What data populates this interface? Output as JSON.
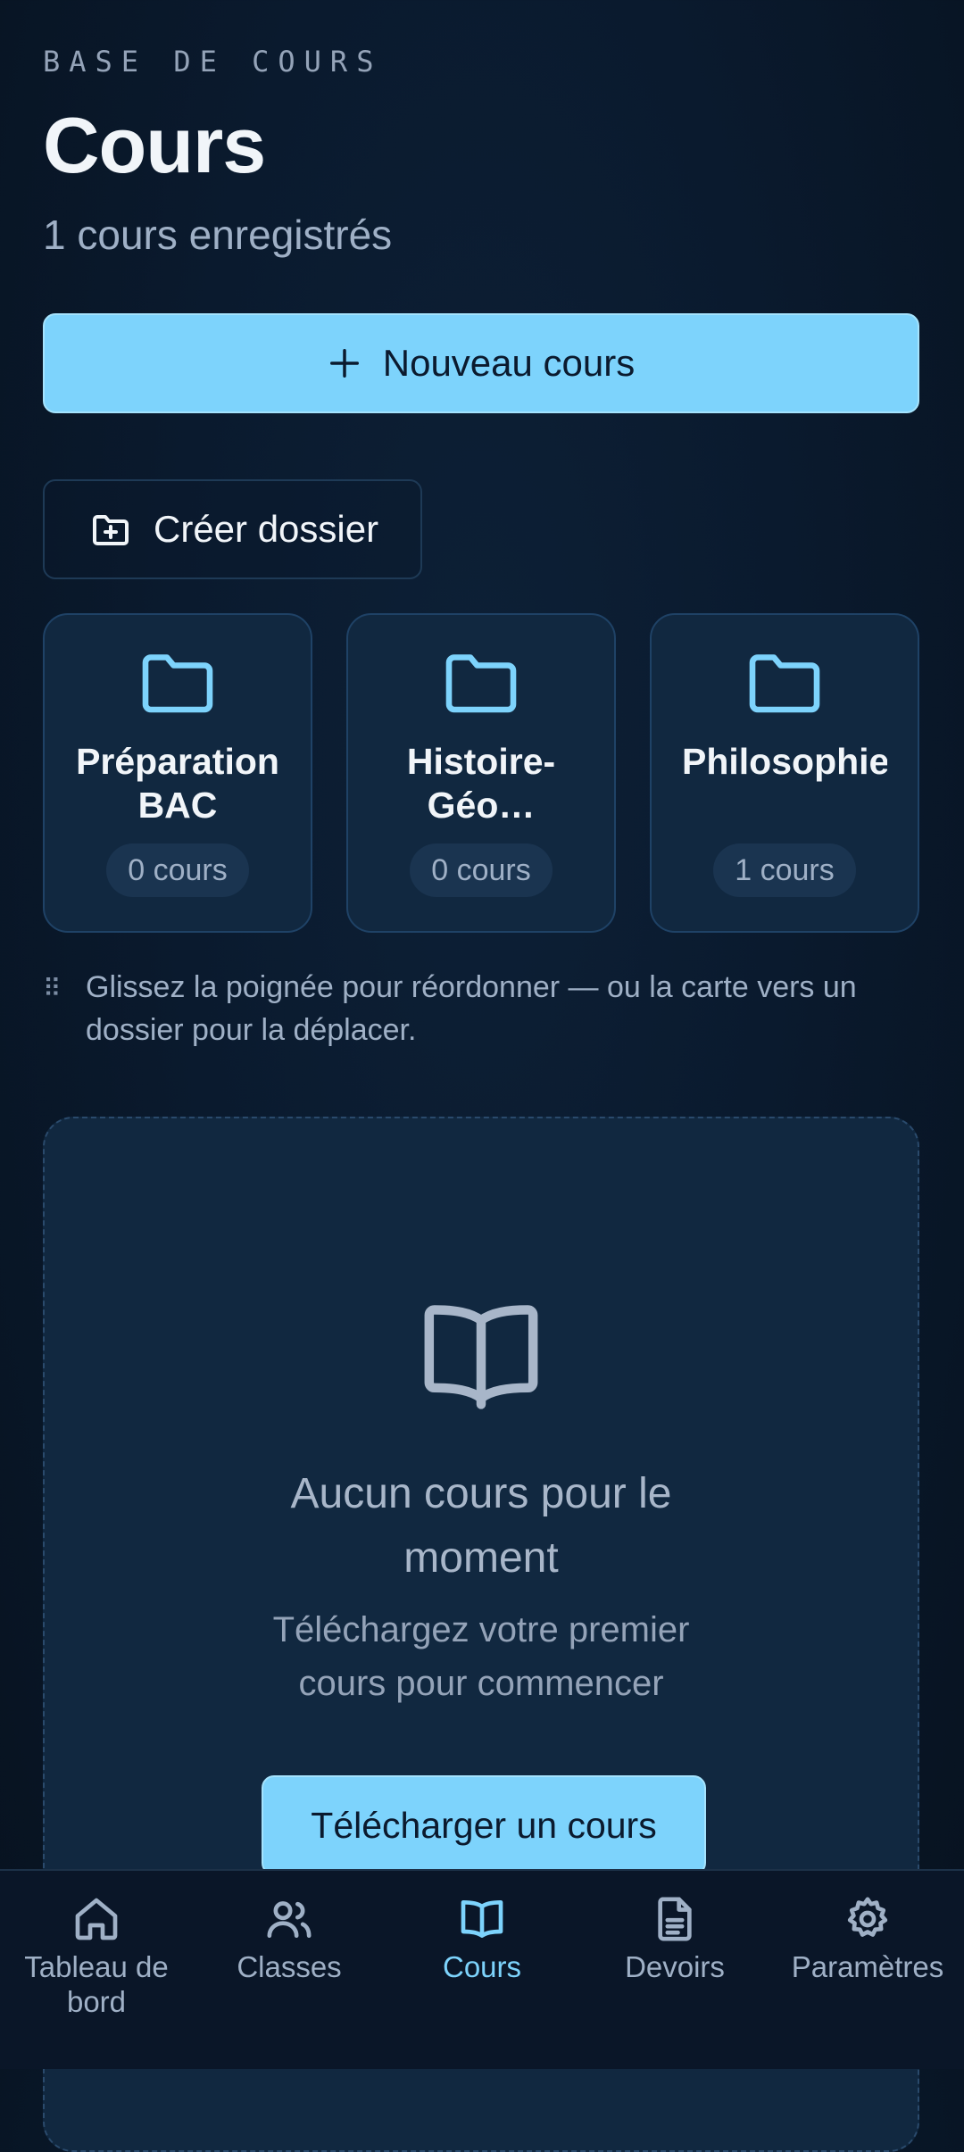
{
  "header": {
    "eyebrow": "BASE DE COURS",
    "title": "Cours",
    "subtitle": "1 cours enregistrés"
  },
  "actions": {
    "new_course": "Nouveau cours",
    "create_folder": "Créer dossier"
  },
  "folders": [
    {
      "name": "Préparation BAC",
      "count": "0 cours",
      "icon": "folder-icon"
    },
    {
      "name": "Histoire-Géo…",
      "count": "0 cours",
      "icon": "folder-icon"
    },
    {
      "name": "Philosophie…",
      "count": "1 cours",
      "icon": "folder-icon"
    }
  ],
  "hint": {
    "icon": "grip-icon",
    "text": "Glissez la poignée pour réordonner — ou la carte vers un dossier pour la déplacer."
  },
  "empty_state": {
    "icon": "book-open-icon",
    "title": "Aucun cours pour le moment",
    "subtitle": "Téléchargez votre premier cours pour commencer",
    "button": "Télécharger un cours"
  },
  "nav": {
    "items": [
      {
        "label": "Tableau de bord",
        "icon": "home-icon",
        "active": false
      },
      {
        "label": "Classes",
        "icon": "users-icon",
        "active": false
      },
      {
        "label": "Cours",
        "icon": "book-open-icon",
        "active": true
      },
      {
        "label": "Devoirs",
        "icon": "document-icon",
        "active": false
      },
      {
        "label": "Paramètres",
        "icon": "gear-icon",
        "active": false
      }
    ]
  },
  "colors": {
    "background": "#0a1a2e",
    "card": "#112840",
    "accent": "#7dd3fc",
    "muted_text": "#9fb0c6"
  }
}
